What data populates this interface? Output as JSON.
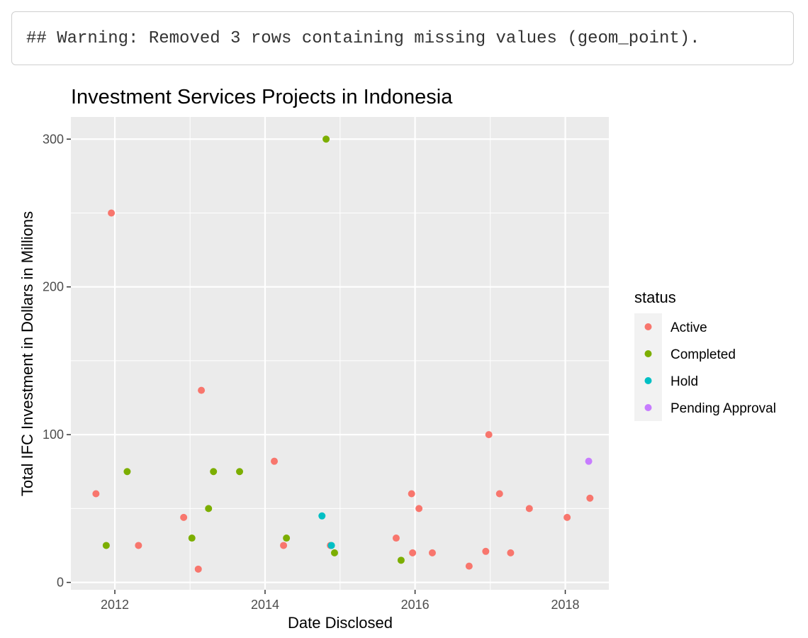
{
  "console": {
    "warning": "## Warning: Removed 3 rows containing missing values (geom_point)."
  },
  "chart_data": {
    "type": "scatter",
    "title": "Investment Services Projects in Indonesia",
    "xlabel": "Date Disclosed",
    "ylabel": "Total IFC Investment in Dollars in Millions",
    "xlim": [
      "2011-06-01",
      "2018-08-01"
    ],
    "ylim": [
      -5,
      315
    ],
    "x_ticks": [
      {
        "date": "2012-01-01",
        "label": "2012"
      },
      {
        "date": "2014-01-01",
        "label": "2014"
      },
      {
        "date": "2016-01-01",
        "label": "2016"
      },
      {
        "date": "2018-01-01",
        "label": "2018"
      }
    ],
    "y_ticks": [
      0,
      100,
      200,
      300
    ],
    "grid": true,
    "panel_background": "#ebebeb",
    "legend": {
      "title": "status",
      "position": "right",
      "entries": [
        {
          "label": "Active",
          "color": "#F8766D"
        },
        {
          "label": "Completed",
          "color": "#7CAE00"
        },
        {
          "label": "Hold",
          "color": "#00BFC4"
        },
        {
          "label": "Pending Approval",
          "color": "#C77CFF"
        }
      ]
    },
    "series": [
      {
        "name": "Active",
        "color": "#F8766D",
        "points": [
          {
            "x": "2011-10-01",
            "y": 60
          },
          {
            "x": "2011-12-15",
            "y": 250
          },
          {
            "x": "2012-04-25",
            "y": 25
          },
          {
            "x": "2012-12-01",
            "y": 44
          },
          {
            "x": "2013-02-10",
            "y": 9
          },
          {
            "x": "2013-02-25",
            "y": 130
          },
          {
            "x": "2014-02-15",
            "y": 82
          },
          {
            "x": "2014-04-01",
            "y": 25
          },
          {
            "x": "2014-11-15",
            "y": 25
          },
          {
            "x": "2015-10-01",
            "y": 30
          },
          {
            "x": "2015-12-15",
            "y": 60
          },
          {
            "x": "2015-12-20",
            "y": 20
          },
          {
            "x": "2016-01-20",
            "y": 50
          },
          {
            "x": "2016-03-25",
            "y": 20
          },
          {
            "x": "2016-09-20",
            "y": 11
          },
          {
            "x": "2016-12-10",
            "y": 21
          },
          {
            "x": "2016-12-25",
            "y": 100
          },
          {
            "x": "2017-02-15",
            "y": 60
          },
          {
            "x": "2017-04-10",
            "y": 20
          },
          {
            "x": "2017-07-10",
            "y": 50
          },
          {
            "x": "2018-01-10",
            "y": 44
          },
          {
            "x": "2018-05-01",
            "y": 57
          }
        ]
      },
      {
        "name": "Completed",
        "color": "#7CAE00",
        "points": [
          {
            "x": "2011-11-20",
            "y": 25
          },
          {
            "x": "2012-03-01",
            "y": 75
          },
          {
            "x": "2013-01-10",
            "y": 30
          },
          {
            "x": "2013-04-01",
            "y": 50
          },
          {
            "x": "2013-04-25",
            "y": 75
          },
          {
            "x": "2013-08-30",
            "y": 75
          },
          {
            "x": "2014-04-15",
            "y": 30
          },
          {
            "x": "2014-10-25",
            "y": 300
          },
          {
            "x": "2014-12-05",
            "y": 20
          },
          {
            "x": "2015-10-25",
            "y": 15
          }
        ]
      },
      {
        "name": "Hold",
        "color": "#00BFC4",
        "points": [
          {
            "x": "2014-10-05",
            "y": 45
          },
          {
            "x": "2014-11-20",
            "y": 25
          }
        ]
      },
      {
        "name": "Pending Approval",
        "color": "#C77CFF",
        "points": [
          {
            "x": "2018-04-25",
            "y": 82
          }
        ]
      }
    ]
  }
}
